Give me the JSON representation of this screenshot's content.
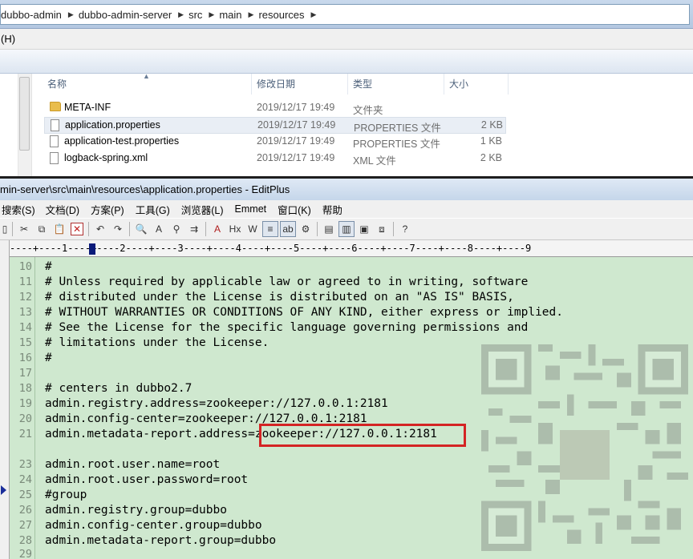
{
  "explorer": {
    "breadcrumb": [
      "dubbo-admin",
      "dubbo-admin-server",
      "src",
      "main",
      "resources"
    ],
    "menu_help": "(H)",
    "columns": {
      "name": "名称",
      "date": "修改日期",
      "type": "类型",
      "size": "大小"
    },
    "files": [
      {
        "name": "META-INF",
        "date": "2019/12/17 19:49",
        "type": "文件夹",
        "size": "",
        "icon": "folder-icon"
      },
      {
        "name": "application.properties",
        "date": "2019/12/17 19:49",
        "type": "PROPERTIES 文件",
        "size": "2 KB",
        "icon": "file-icon",
        "selected": true
      },
      {
        "name": "application-test.properties",
        "date": "2019/12/17 19:49",
        "type": "PROPERTIES 文件",
        "size": "1 KB",
        "icon": "file-icon"
      },
      {
        "name": "logback-spring.xml",
        "date": "2019/12/17 19:49",
        "type": "XML 文件",
        "size": "2 KB",
        "icon": "file-icon"
      }
    ]
  },
  "editplus": {
    "title": "min-server\\src\\main\\resources\\application.properties - EditPlus",
    "menu": [
      "搜索(S)",
      "文档(D)",
      "方案(P)",
      "工具(G)",
      "浏览器(L)",
      "Emmet",
      "窗口(K)",
      "帮助"
    ],
    "ruler": "----+----1----+----2----+----3----+----4----+----5----+----6----+----7----+----8----+----9",
    "bookmark_line": 25,
    "lines": [
      {
        "n": "10",
        "text": "#"
      },
      {
        "n": "11",
        "text": "# Unless required by applicable law or agreed to in writing, software"
      },
      {
        "n": "12",
        "text": "# distributed under the License is distributed on an \"AS IS\" BASIS,"
      },
      {
        "n": "13",
        "text": "# WITHOUT WARRANTIES OR CONDITIONS OF ANY KIND, either express or implied."
      },
      {
        "n": "14",
        "text": "# See the License for the specific language governing permissions and"
      },
      {
        "n": "15",
        "text": "# limitations under the License."
      },
      {
        "n": "16",
        "text": "#"
      },
      {
        "n": "17",
        "text": ""
      },
      {
        "n": "18",
        "text": "# centers in dubbo2.7"
      },
      {
        "n": "19",
        "text": "admin.registry.address=zookeeper://127.0.0.1:2181"
      },
      {
        "n": "20",
        "text": "admin.config-center=zookeeper://127.0.0.1:2181"
      },
      {
        "n": "21",
        "text": "admin.metadata-report.address=zookeeper://127.0.0.1:2181"
      },
      {
        "n": "",
        "text": ""
      },
      {
        "n": "23",
        "text": "admin.root.user.name=root"
      },
      {
        "n": "24",
        "text": "admin.root.user.password=root"
      },
      {
        "n": "25",
        "text": "#group"
      },
      {
        "n": "26",
        "text": "admin.registry.group=dubbo"
      },
      {
        "n": "27",
        "text": "admin.config-center.group=dubbo"
      },
      {
        "n": "28",
        "text": "admin.metadata-report.group=dubbo"
      },
      {
        "n": "",
        "text": ""
      },
      {
        "n": "29",
        "text": ""
      }
    ]
  },
  "colors": {
    "editor_bg": "#cfe8cf",
    "highlight": "#d42424",
    "selection": "#e9eef5"
  }
}
